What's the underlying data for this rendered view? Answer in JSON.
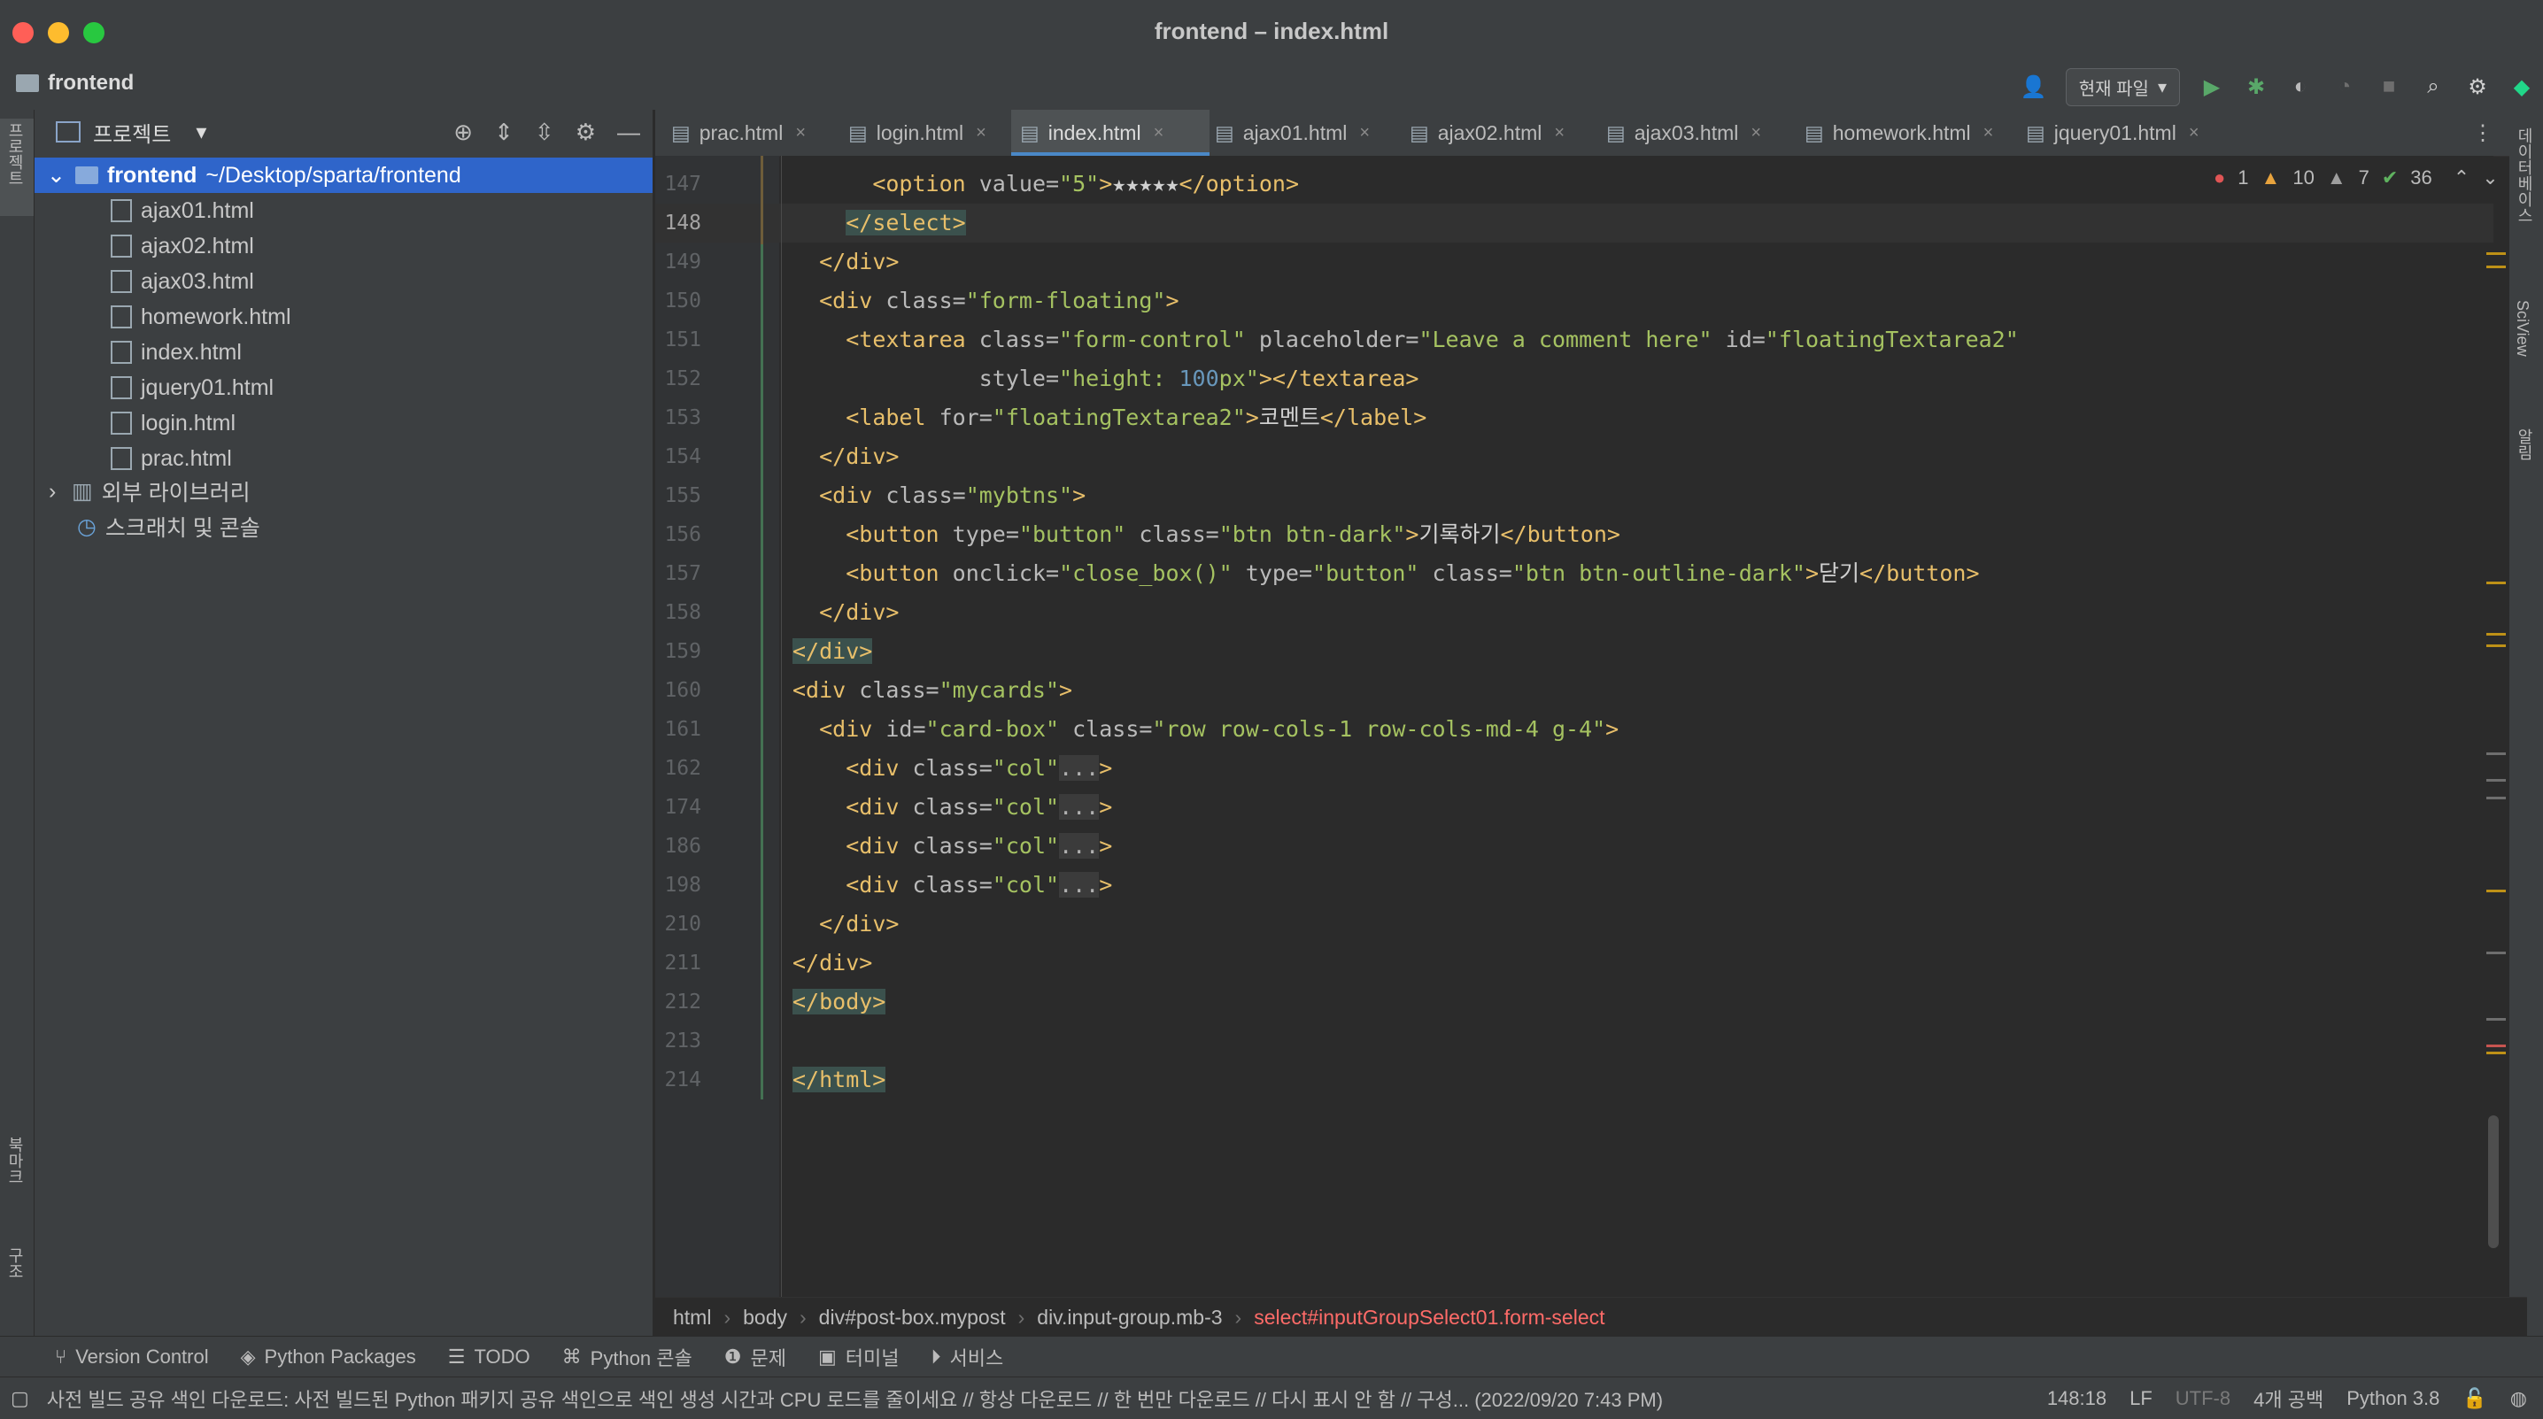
{
  "window": {
    "title": "frontend – index.html"
  },
  "navbar": {
    "project_name": "frontend",
    "run_config": "현재 파일"
  },
  "left_strip": {
    "project_label": "프로젝트",
    "bookmarks_label": "북마크",
    "structure_label": "구조"
  },
  "right_strip": {
    "database_label": "데이터베이스",
    "sciview_label": "SciView",
    "notifications_label": "알림"
  },
  "project_panel": {
    "title": "프로젝트",
    "root": {
      "name": "frontend",
      "path": "~/Desktop/sparta/frontend"
    },
    "files": [
      "ajax01.html",
      "ajax02.html",
      "ajax03.html",
      "homework.html",
      "index.html",
      "jquery01.html",
      "login.html",
      "prac.html"
    ],
    "external_libraries": "외부 라이브러리",
    "scratches": "스크래치 및 콘솔"
  },
  "tabs": [
    {
      "label": "prac.html",
      "active": false
    },
    {
      "label": "login.html",
      "active": false
    },
    {
      "label": "index.html",
      "active": true
    },
    {
      "label": "ajax01.html",
      "active": false
    },
    {
      "label": "ajax02.html",
      "active": false
    },
    {
      "label": "ajax03.html",
      "active": false
    },
    {
      "label": "homework.html",
      "active": false
    },
    {
      "label": "jquery01.html",
      "active": false
    }
  ],
  "inspections": {
    "errors": "1",
    "warnings": "10",
    "weak_warnings": "7",
    "ok": "36"
  },
  "code": {
    "line_numbers": [
      "147",
      "148",
      "149",
      "150",
      "151",
      "152",
      "153",
      "154",
      "155",
      "156",
      "157",
      "158",
      "159",
      "160",
      "161",
      "162",
      "174",
      "186",
      "198",
      "210",
      "211",
      "212",
      "213",
      "214"
    ],
    "current_line": "148"
  },
  "breadcrumbs": [
    "html",
    "body",
    "div#post-box.mypost",
    "div.input-group.mb-3",
    "select#inputGroupSelect01.form-select"
  ],
  "bottom_tools": [
    "Version Control",
    "Python Packages",
    "TODO",
    "Python 콘솔",
    "문제",
    "터미널",
    "서비스"
  ],
  "status": {
    "message": "사전 빌드 공유 색인 다운로드: 사전 빌드된 Python 패키지 공유 색인으로 색인 생성 시간과 CPU 로드를 줄이세요 // 항상 다운로드 // 한 번만 다운로드 // 다시 표시 안 함 // 구성... (2022/09/20 7:43 PM)",
    "position": "148:18",
    "line_sep": "LF",
    "encoding": "UTF-8",
    "indent": "4개 공백",
    "interpreter": "Python 3.8"
  },
  "colors": {
    "selection": "#2f65ca",
    "tag": "#e8bf6a",
    "string": "#a5c261",
    "number": "#6897bb",
    "attribute": "#bababa",
    "error_breadcrumb": "#ff6b68"
  }
}
